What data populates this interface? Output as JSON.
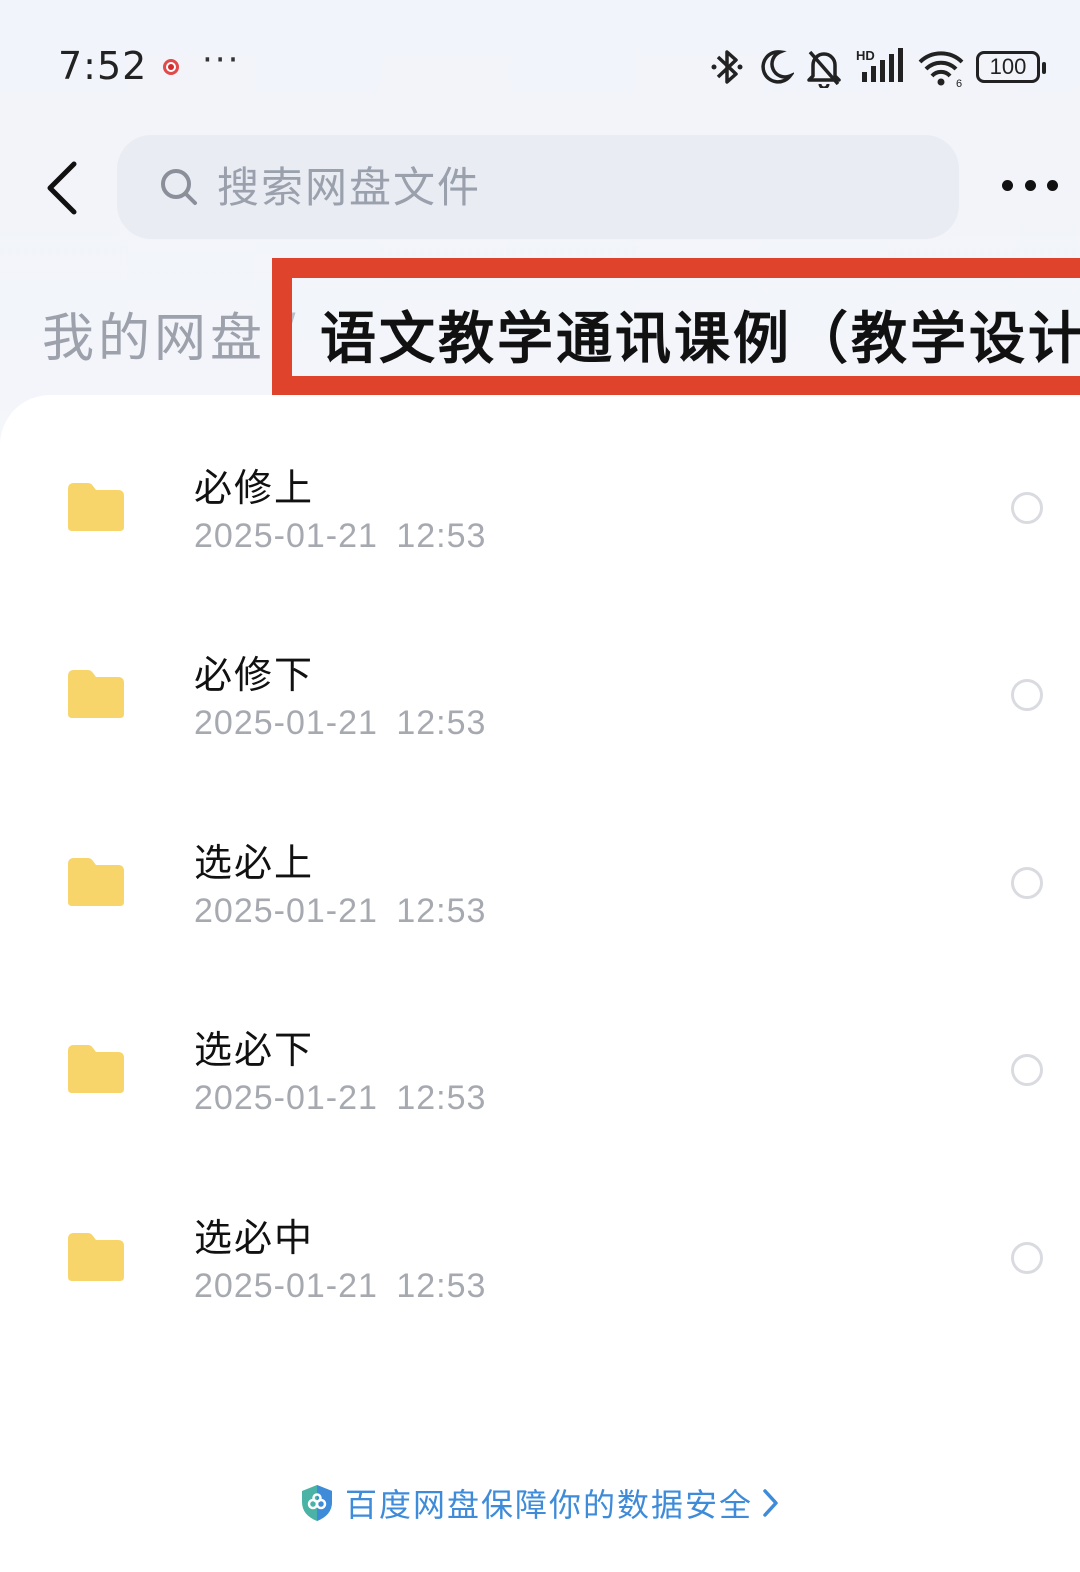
{
  "status_bar": {
    "time": "7:52",
    "more": "···",
    "battery": "100",
    "icons": [
      "bluetooth-icon",
      "moon-icon",
      "bell-muted-icon",
      "hd-signal-icon",
      "wifi-icon",
      "battery-icon"
    ]
  },
  "header": {
    "search_placeholder": "搜索网盘文件"
  },
  "breadcrumb": {
    "root": "我的网盘",
    "separator": "/",
    "current": "语文教学通讯课例（教学设计）",
    "highlight_color": "#e0432b"
  },
  "files": [
    {
      "name": "必修上",
      "date": "2025-01-21  12:53"
    },
    {
      "name": "必修下",
      "date": "2025-01-21  12:53"
    },
    {
      "name": "选必上",
      "date": "2025-01-21  12:53"
    },
    {
      "name": "选必下",
      "date": "2025-01-21  12:53"
    },
    {
      "name": "选必中",
      "date": "2025-01-21  12:53"
    }
  ],
  "footer": {
    "note": "百度网盘保障你的数据安全"
  },
  "colors": {
    "folder": "#f7d56a",
    "accent": "#3e8bd9"
  }
}
